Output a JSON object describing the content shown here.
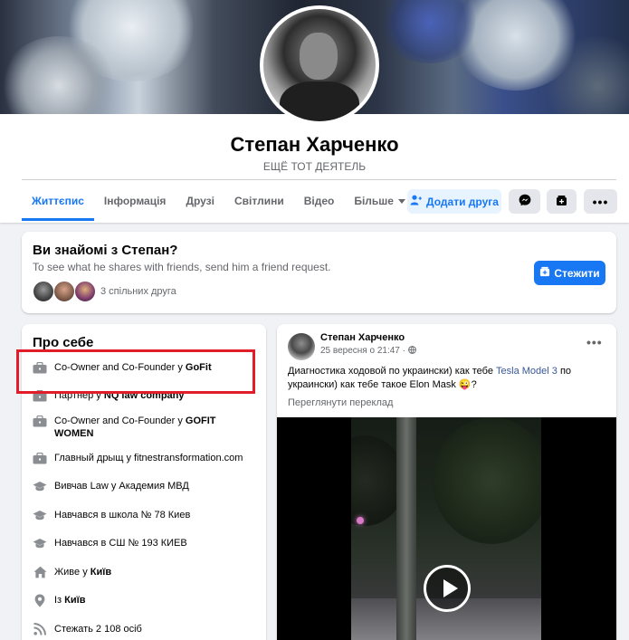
{
  "profile": {
    "name": "Степан Харченко",
    "subtitle": "ЕЩЁ ТОТ ДЕЯТЕЛЬ"
  },
  "tabs": [
    {
      "label": "Життєпис",
      "active": true
    },
    {
      "label": "Інформація"
    },
    {
      "label": "Друзі"
    },
    {
      "label": "Світлини"
    },
    {
      "label": "Відео"
    },
    {
      "label": "Більше"
    }
  ],
  "actions": {
    "add_friend": "Додати друга",
    "messenger_icon": "messenger-icon",
    "follow_icon": "follow-icon",
    "more": "•••"
  },
  "know_card": {
    "title": "Ви знайомі з Степан?",
    "text": "To see what he shares with friends, send him a friend request.",
    "mutual": "3 спільних друга",
    "follow_button": "Стежити"
  },
  "about": {
    "title": "Про себе",
    "items": [
      {
        "icon": "briefcase-icon",
        "text": "Co-Owner and Co-Founder у ",
        "bold": "GoFit"
      },
      {
        "icon": "briefcase-icon",
        "text": "Партнер у ",
        "bold": "NQ law company"
      },
      {
        "icon": "briefcase-icon",
        "text": "Co-Owner and Co-Founder у ",
        "bold": "GOFIT WOMEN"
      },
      {
        "icon": "briefcase-icon",
        "text": "Главный дрыщ у fitnestransformation.com",
        "bold": ""
      },
      {
        "icon": "graduation-cap-icon",
        "text": "Вивчав Law у Академия МВД",
        "bold": ""
      },
      {
        "icon": "graduation-cap-icon",
        "text": "Навчався в школа № 78 Киев",
        "bold": ""
      },
      {
        "icon": "graduation-cap-icon",
        "text": "Навчався в СШ № 193 КИЕВ",
        "bold": ""
      },
      {
        "icon": "home-icon",
        "text": "Живе у ",
        "bold": "Київ"
      },
      {
        "icon": "location-pin-icon",
        "text": "Із ",
        "bold": "Київ"
      },
      {
        "icon": "rss-icon",
        "text": "Стежать 2 108 осіб",
        "bold": ""
      }
    ]
  },
  "post": {
    "author": "Степан Харченко",
    "date": "25 вересня о 21:47 · ",
    "globe_icon": "globe-icon",
    "text_before": "Диагностика ходовой по украински) как тебе такое Elon Mask ",
    "text_link": "Tesla Model 3",
    "text_pre_link": "Диагностика ходовой по украински) как тебе ",
    "emoji": "😜",
    "translate": "Переглянути переклад"
  },
  "colors": {
    "accent": "#1877f2",
    "background": "#f0f2f5",
    "highlight_box": "#e11d2a"
  }
}
